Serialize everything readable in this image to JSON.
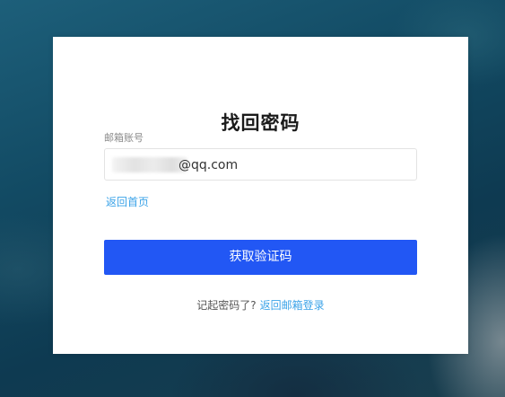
{
  "page": {
    "title": "找回密码"
  },
  "form": {
    "email_label": "邮箱账号",
    "email_value": "@qq.com",
    "back_home_link": "返回首页",
    "submit_button": "获取验证码"
  },
  "footer": {
    "question": "记起密码了?",
    "link": "返回邮箱登录"
  },
  "colors": {
    "primary_button": "#2257f4",
    "link": "#3ba3e8"
  }
}
